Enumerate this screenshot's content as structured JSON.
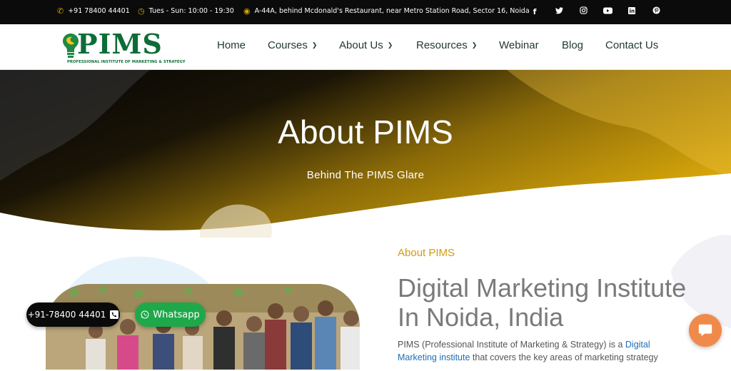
{
  "topbar": {
    "phone": "+91 78400 44401",
    "hours": "Tues - Sun: 10:00 - 19:30",
    "address": "A-44A, behind Mcdonald's Restaurant, near Metro Station Road, Sector 16, Noida",
    "socials": [
      "facebook-icon",
      "twitter-icon",
      "instagram-icon",
      "youtube-icon",
      "linkedin-icon",
      "pinterest-icon"
    ]
  },
  "logo": {
    "text": "PIMS",
    "tagline": "PROFESSIONAL INSTITUTE OF MARKETING & STRATEGY"
  },
  "nav": {
    "items": [
      {
        "label": "Home"
      },
      {
        "label": "Courses"
      },
      {
        "label": "About Us"
      },
      {
        "label": "Resources"
      },
      {
        "label": "Webinar"
      },
      {
        "label": "Blog"
      },
      {
        "label": "Contact Us"
      }
    ]
  },
  "hero": {
    "title": "About PIMS",
    "subtitle": "Behind The PIMS Glare"
  },
  "content": {
    "section_label": "About PIMS",
    "heading": "Digital Marketing Institute In Noida, India",
    "para_start": "PIMS (Professional Institute of Marketing & Strategy) is a ",
    "para_link": "Digital Marketing institute",
    "para_end": " that covers the key areas of marketing strategy"
  },
  "floating": {
    "call_label": "+91-78400 44401",
    "whatsapp_label": "Whatsapp"
  },
  "colors": {
    "accent_gold": "#d49a0a",
    "brand_green": "#0e6d37",
    "whatsapp_green": "#1ea84a",
    "chat_orange": "#f08a4b"
  }
}
